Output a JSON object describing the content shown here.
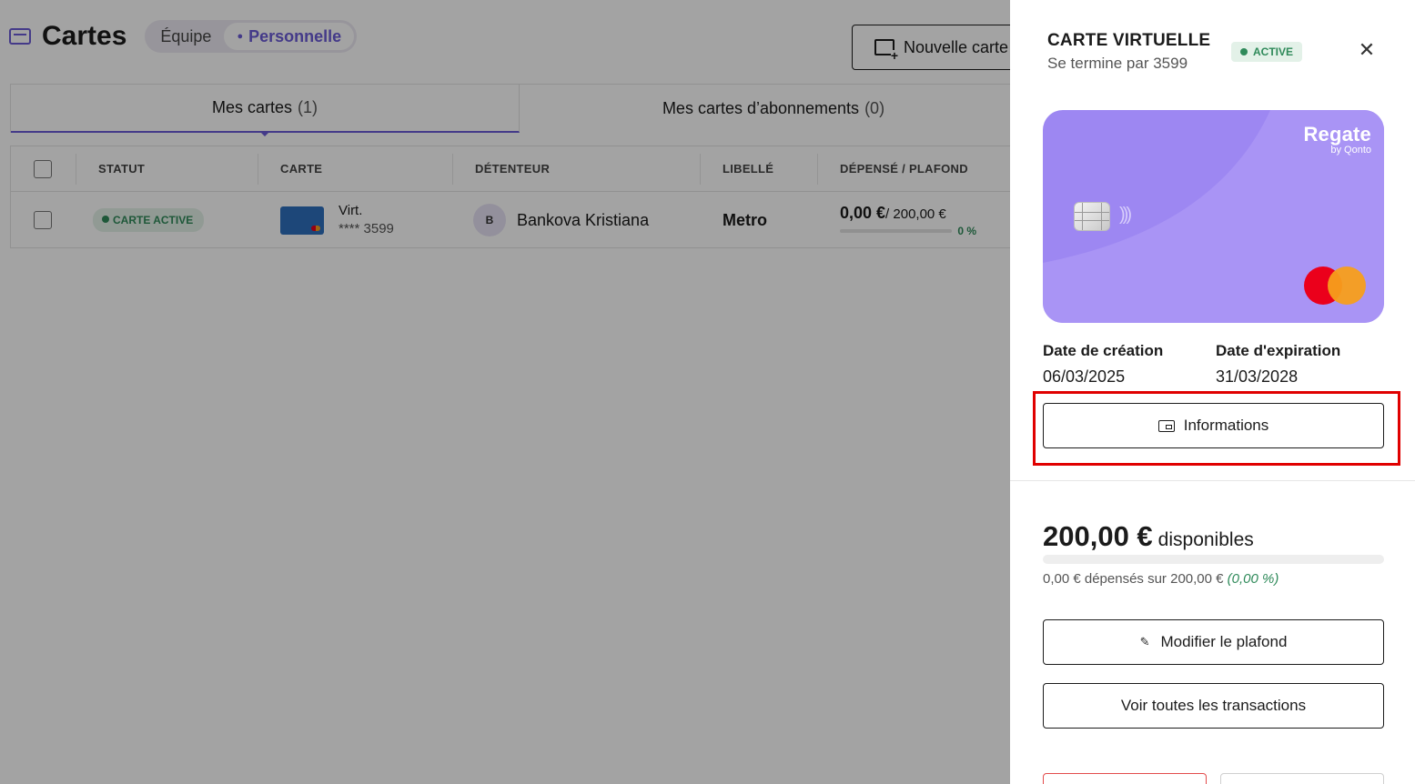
{
  "header": {
    "title": "Cartes",
    "segments": [
      "Équipe",
      "Personnelle"
    ],
    "new_card_label": "Nouvelle carte"
  },
  "tabs": [
    {
      "label": "Mes cartes",
      "count": "(1)"
    },
    {
      "label": "Mes cartes d’abonnements",
      "count": "(0)"
    }
  ],
  "table": {
    "columns": [
      "STATUT",
      "CARTE",
      "DÉTENTEUR",
      "LIBELLÉ",
      "DÉPENSÉ / PLAFOND"
    ],
    "rows": [
      {
        "status": "CARTE ACTIVE",
        "card_type": "Virt.",
        "card_number": "**** 3599",
        "avatar_initial": "B",
        "holder": "Bankova Kristiana",
        "label": "Metro",
        "spent": "0,00 €",
        "limit": "/ 200,00 €",
        "percent": "0 %"
      }
    ]
  },
  "panel": {
    "title": "CARTE VIRTUELLE",
    "subtitle": "Se termine par 3599",
    "status": "ACTIVE",
    "card_brand": "Regate",
    "card_brand_by": "by Qonto",
    "creation_label": "Date de création",
    "creation_value": "06/03/2025",
    "expiration_label": "Date d'expiration",
    "expiration_value": "31/03/2028",
    "info_button": "Informations",
    "available_amount": "200,00 €",
    "available_label": "disponibles",
    "spent_text": "0,00 € dépensés sur 200,00 €",
    "spent_percent": "(0,00 %)",
    "spent_fraction": 0,
    "modify_limit_button": "Modifier le plafond",
    "all_transactions_button": "Voir toutes les transactions"
  },
  "colors": {
    "accent": "#6b5bd6",
    "card": "#9d87f2",
    "success": "#2f8a5a",
    "highlight": "#e00000"
  }
}
